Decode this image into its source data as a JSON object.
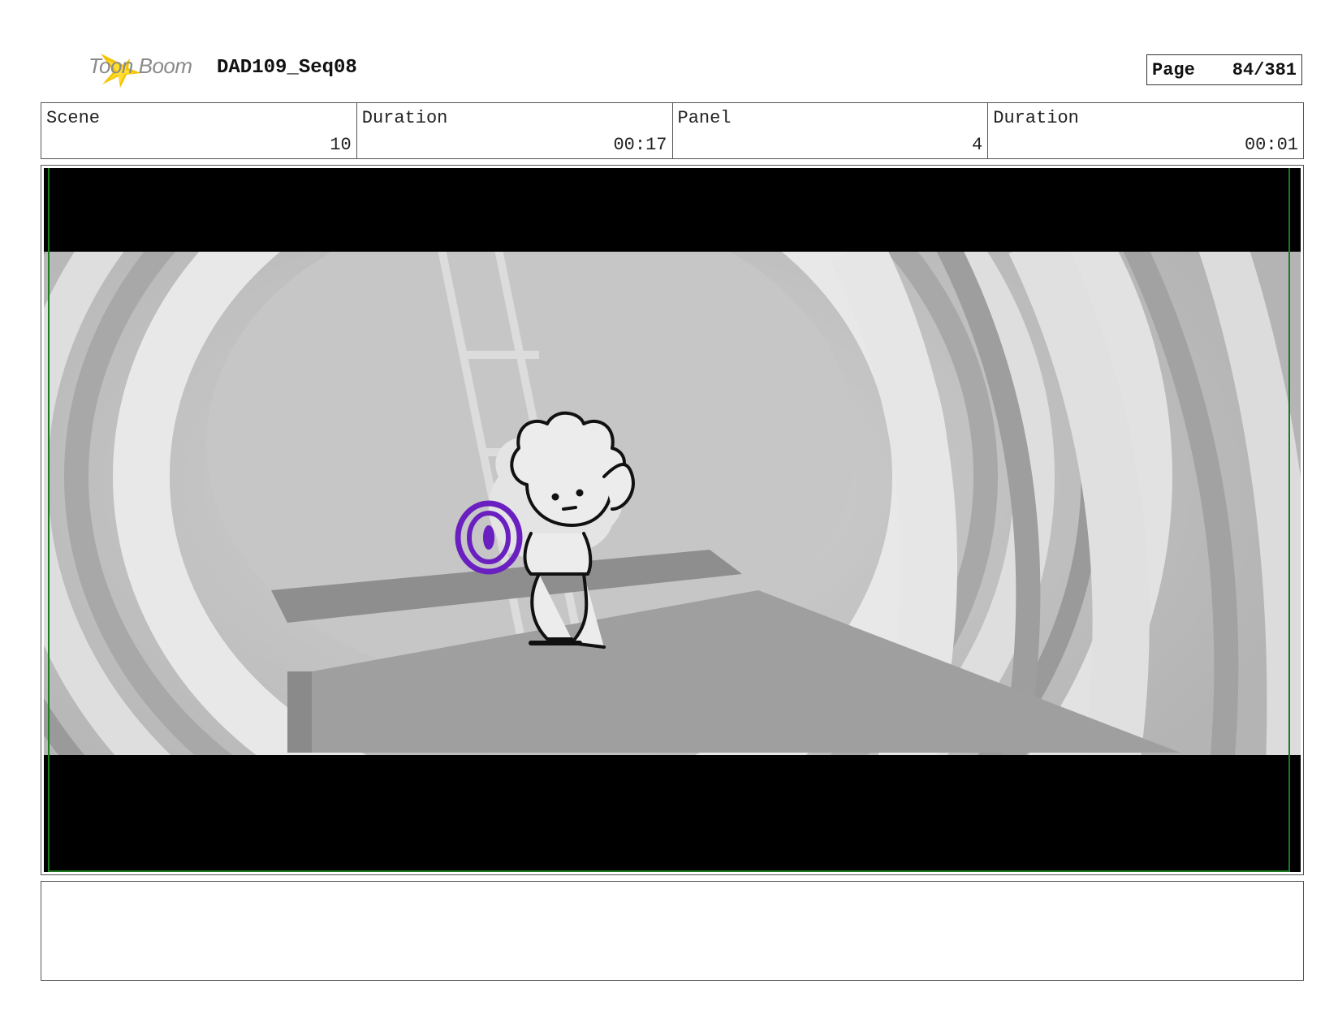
{
  "header": {
    "logo_text": "Toon Boom",
    "project": "DAD109_Seq08",
    "page_label": "Page",
    "page_value": "84/381"
  },
  "info": {
    "scene_label": "Scene",
    "scene_value": "10",
    "scene_duration_label": "Duration",
    "scene_duration_value": "00:17",
    "panel_label": "Panel",
    "panel_value": "4",
    "panel_duration_label": "Duration",
    "panel_duration_value": "00:01"
  },
  "colors": {
    "safe_frame": "#1e7a1e",
    "prop_purple": "#6a1fc0",
    "letterbox": "#000000"
  },
  "notes": {
    "text": ""
  }
}
